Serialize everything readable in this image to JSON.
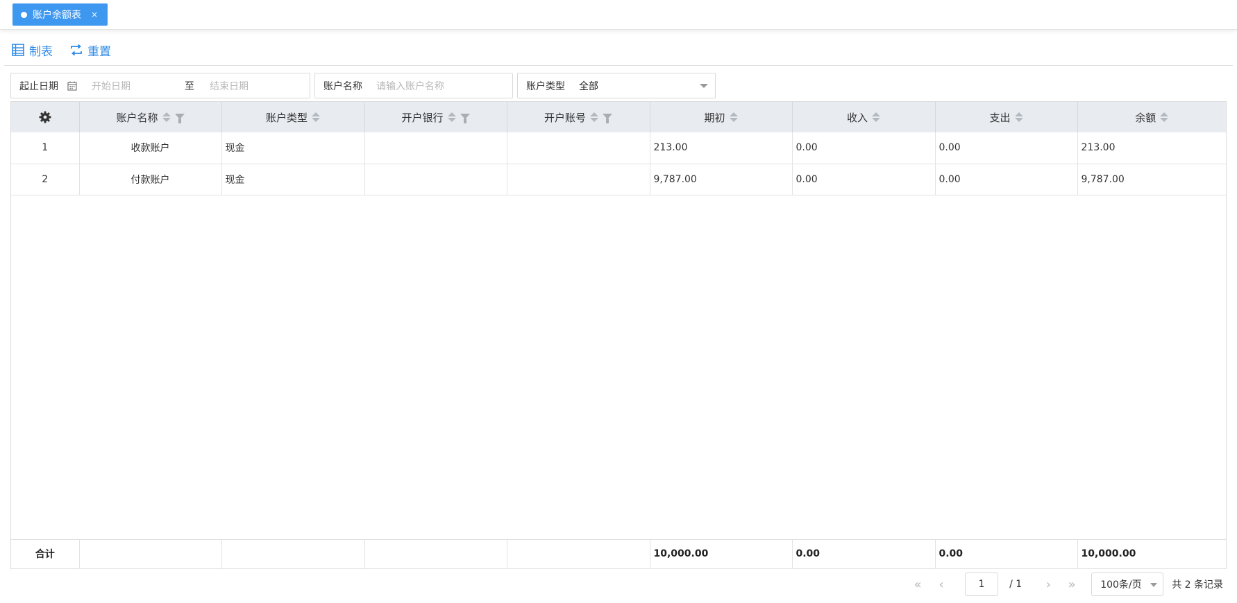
{
  "tab": {
    "label": "账户余额表",
    "close": "×"
  },
  "toolbar": {
    "make_label": "制表",
    "reset_label": "重置"
  },
  "filters": {
    "date_label": "起止日期",
    "start_placeholder": "开始日期",
    "to_label": "至",
    "end_placeholder": "结束日期",
    "name_label": "账户名称",
    "name_placeholder": "请输入账户名称",
    "type_label": "账户类型",
    "type_value": "全部"
  },
  "table": {
    "headers": [
      "账户名称",
      "账户类型",
      "开户银行",
      "开户账号",
      "期初",
      "收入",
      "支出",
      "余额"
    ],
    "rows": [
      {
        "index": "1",
        "name": "收款账户",
        "type": "现金",
        "bank": "",
        "account": "",
        "opening": "213.00",
        "income": "0.00",
        "expense": "0.00",
        "balance": "213.00"
      },
      {
        "index": "2",
        "name": "付款账户",
        "type": "现金",
        "bank": "",
        "account": "",
        "opening": "9,787.00",
        "income": "0.00",
        "expense": "0.00",
        "balance": "9,787.00"
      }
    ],
    "footer": {
      "label": "合计",
      "opening": "10,000.00",
      "income": "0.00",
      "expense": "0.00",
      "balance": "10,000.00"
    }
  },
  "pager": {
    "first": "«",
    "prev": "‹",
    "page": "1",
    "total_pages": "/ 1",
    "next": "›",
    "last": "»",
    "page_size": "100条/页",
    "count": "共 2 条记录"
  },
  "colors": {
    "accent": "#3e98f0",
    "header_bg": "#e8ecf1",
    "link": "#2e8ae6"
  }
}
